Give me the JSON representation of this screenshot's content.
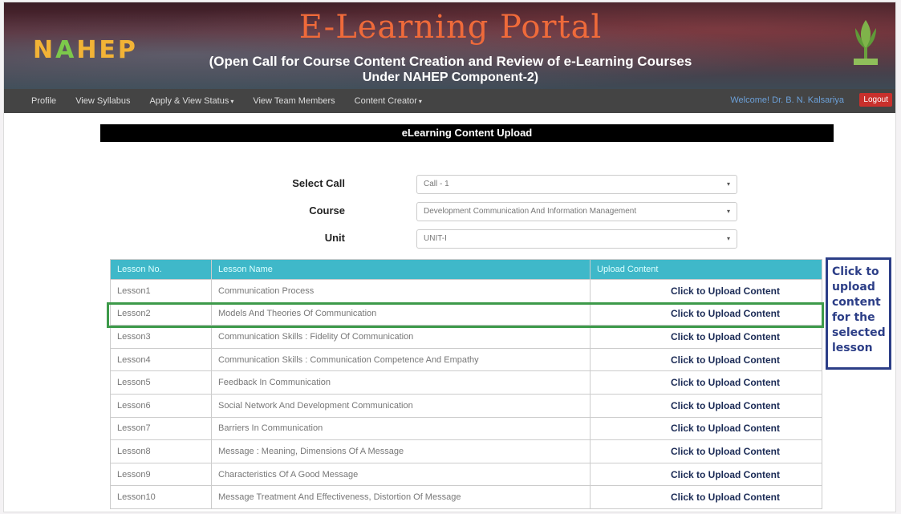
{
  "header": {
    "logo_text": "NAHEP",
    "title": "E-Learning Portal",
    "subtitle_line1": "(Open Call for Course Content Creation and Review of e-Learning Courses",
    "subtitle_line2": "Under NAHEP Component-2)",
    "emblem": "icar-emblem"
  },
  "nav": {
    "items": [
      {
        "label": "Profile"
      },
      {
        "label": "View Syllabus"
      },
      {
        "label": "Apply & View Status",
        "dropdown": true
      },
      {
        "label": "View Team Members"
      },
      {
        "label": "Content Creator",
        "dropdown": true
      }
    ],
    "welcome": "Welcome! Dr. B. N. Kalsariya",
    "logout": "Logout"
  },
  "page_title": "eLearning Content Upload",
  "form": {
    "call": {
      "label": "Select Call",
      "value": "Call - 1"
    },
    "course": {
      "label": "Course",
      "value": "Development Communication And Information Management"
    },
    "unit": {
      "label": "Unit",
      "value": "UNIT-I"
    }
  },
  "table": {
    "headers": [
      "Lesson No.",
      "Lesson Name",
      "Upload Content"
    ],
    "rows": [
      {
        "no": "Lesson1",
        "name": "Communication Process",
        "action": "Click to Upload Content"
      },
      {
        "no": "Lesson2",
        "name": "Models And Theories Of Communication",
        "action": "Click to Upload Content"
      },
      {
        "no": "Lesson3",
        "name": "Communication Skills : Fidelity Of Communication",
        "action": "Click to Upload Content"
      },
      {
        "no": "Lesson4",
        "name": "Communication Skills : Communication Competence And Empathy",
        "action": "Click to Upload Content"
      },
      {
        "no": "Lesson5",
        "name": "Feedback In Communication",
        "action": "Click to Upload Content"
      },
      {
        "no": "Lesson6",
        "name": "Social Network And Development Communication",
        "action": "Click to Upload Content"
      },
      {
        "no": "Lesson7",
        "name": "Barriers In Communication",
        "action": "Click to Upload Content"
      },
      {
        "no": "Lesson8",
        "name": "Message : Meaning, Dimensions Of A Message",
        "action": "Click to Upload Content"
      },
      {
        "no": "Lesson9",
        "name": "Characteristics Of A Good Message",
        "action": "Click to Upload Content"
      },
      {
        "no": "Lesson10",
        "name": "Message Treatment And Effectiveness, Distortion Of Message",
        "action": "Click to Upload Content"
      }
    ]
  },
  "callout": "Click to upload content for the selected lesson",
  "colors": {
    "accent": "#3fb8c9",
    "highlight": "#3d9a4a",
    "callout": "#2c3e87",
    "title_orange": "#ef6a3a"
  }
}
